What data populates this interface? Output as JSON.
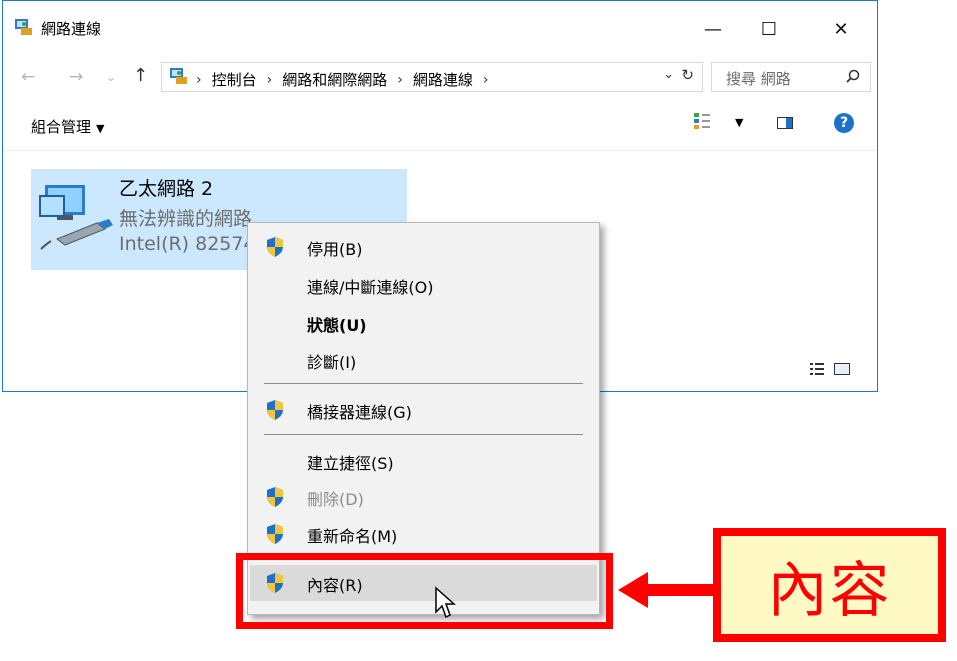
{
  "window": {
    "title": "網路連線",
    "controls": {
      "minimize": "—",
      "maximize": "☐",
      "close": "✕"
    }
  },
  "navigation": {
    "back": "←",
    "forward": "→",
    "recent": "⌄",
    "up": "↑",
    "breadcrumbs": [
      "控制台",
      "網路和網際網路",
      "網路連線"
    ],
    "separator": "›",
    "dropdown": "⌄",
    "refresh": "↻",
    "search_placeholder": "搜尋 網路"
  },
  "command_bar": {
    "organize_label": "組合管理",
    "caret": "▼"
  },
  "connection": {
    "name": "乙太網路 2",
    "status": "無法辨識的網路",
    "adapter": "Intel(R) 82574L"
  },
  "context_menu": {
    "items": [
      {
        "label": "停用(B)",
        "shield": true,
        "disabled": false
      },
      {
        "label": "連線/中斷連線(O)",
        "shield": false,
        "disabled": false
      },
      {
        "label": "狀態(U)",
        "shield": false,
        "disabled": false,
        "bold": true
      },
      {
        "label": "診斷(I)",
        "shield": false,
        "disabled": false
      },
      {
        "label": "橋接器連線(G)",
        "shield": true,
        "disabled": false
      },
      {
        "label": "建立捷徑(S)",
        "shield": false,
        "disabled": false
      },
      {
        "label": "刪除(D)",
        "shield": true,
        "disabled": true
      },
      {
        "label": "重新命名(M)",
        "shield": true,
        "disabled": false
      },
      {
        "label": "內容(R)",
        "shield": true,
        "disabled": false,
        "highlighted": true
      }
    ]
  },
  "callout": {
    "text": "內容",
    "color": "#ff0000",
    "background": "#fff9c4"
  },
  "colors": {
    "selection": "#cce8ff",
    "accent": "#1e72c5",
    "menu_bg": "#f2f2f2"
  }
}
